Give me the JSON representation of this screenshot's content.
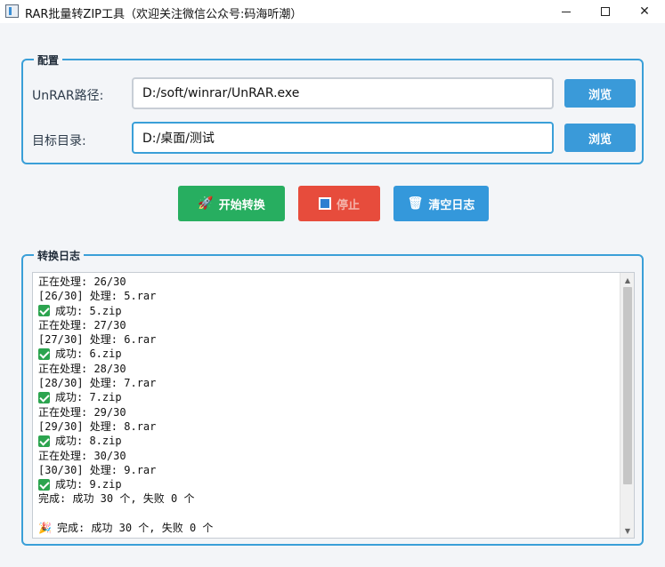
{
  "window": {
    "title": "RAR批量转ZIP工具（欢迎关注微信公众号:码海听潮）"
  },
  "config": {
    "group_title": "配置",
    "unrar_label": "UnRAR路径:",
    "unrar_value": "D:/soft/winrar/UnRAR.exe",
    "target_label": "目标目录:",
    "target_value": "D:/桌面/测试",
    "browse_label": "浏览"
  },
  "actions": {
    "start_label": "开始转换",
    "stop_label": "停止",
    "clear_label": "清空日志"
  },
  "log": {
    "group_title": "转换日志",
    "lines": [
      {
        "type": "text",
        "text": "正在处理: 26/30"
      },
      {
        "type": "text",
        "text": "[26/30] 处理: 5.rar"
      },
      {
        "type": "ok",
        "text": "成功: 5.zip"
      },
      {
        "type": "text",
        "text": "正在处理: 27/30"
      },
      {
        "type": "text",
        "text": "[27/30] 处理: 6.rar"
      },
      {
        "type": "ok",
        "text": "成功: 6.zip"
      },
      {
        "type": "text",
        "text": "正在处理: 28/30"
      },
      {
        "type": "text",
        "text": "[28/30] 处理: 7.rar"
      },
      {
        "type": "ok",
        "text": "成功: 7.zip"
      },
      {
        "type": "text",
        "text": "正在处理: 29/30"
      },
      {
        "type": "text",
        "text": "[29/30] 处理: 8.rar"
      },
      {
        "type": "ok",
        "text": "成功: 8.zip"
      },
      {
        "type": "text",
        "text": "正在处理: 30/30"
      },
      {
        "type": "text",
        "text": "[30/30] 处理: 9.rar"
      },
      {
        "type": "ok",
        "text": "成功: 9.zip"
      },
      {
        "type": "text",
        "text": "完成: 成功 30 个, 失败 0 个"
      },
      {
        "type": "blank",
        "text": ""
      },
      {
        "type": "done",
        "text": "完成: 成功 30 个, 失败 0 个"
      }
    ]
  },
  "colors": {
    "accent": "#3a9fd8",
    "start": "#27ae60",
    "stop": "#e74c3c",
    "clear": "#3498db",
    "success": "#2ca44f"
  },
  "icons": {
    "start": "rocket-icon",
    "stop": "stop-square-icon",
    "clear": "trash-icon",
    "ok": "check-icon",
    "done": "party-popper-icon"
  }
}
